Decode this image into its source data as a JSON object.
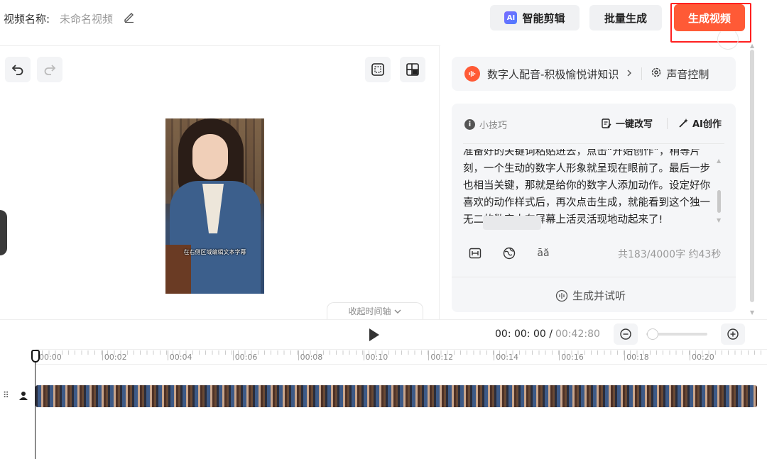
{
  "header": {
    "video_name_label": "视频名称:",
    "video_name_value": "未命名视频",
    "ai_edit_badge": "AI",
    "ai_edit_label": "智能剪辑",
    "batch_label": "批量生成",
    "generate_label": "生成视频",
    "accent_color": "#ff5a36"
  },
  "preview": {
    "subtitle_placeholder": "在右侧区域编辑文本字幕",
    "collapse_timeline_label": "收起时间轴"
  },
  "voice": {
    "name": "数字人配音-积极愉悦讲知识",
    "control_label": "声音控制"
  },
  "script": {
    "tips_label": "小技巧",
    "rewrite_label": "一键改写",
    "ai_create_label": "AI创作",
    "text": "准备好的关键词粘贴进去，点击“开始创作”，稍等片刻，一个生动的数字人形象就呈现在眼前了。最后一步也相当关键，那就是给你的数字人添加动作。设定好你喜欢的动作样式后，再次点击生成，就能看到这个独一无二的数字人在屏幕上活灵活现地动起来了!",
    "tool_icon_3_text": "āă",
    "count_text": "共183/4000字 约43秒",
    "preview_listen_label": "生成并试听"
  },
  "timeline": {
    "current_time": "00:  00:  00 /",
    "total_time": "00:42:80",
    "ticks": [
      "00:00",
      "00:02",
      "00:04",
      "00:06",
      "00:08",
      "00:10",
      "00:12",
      "00:14",
      "00:16",
      "00:18",
      "00:20"
    ],
    "zoom_level": 0.05
  }
}
